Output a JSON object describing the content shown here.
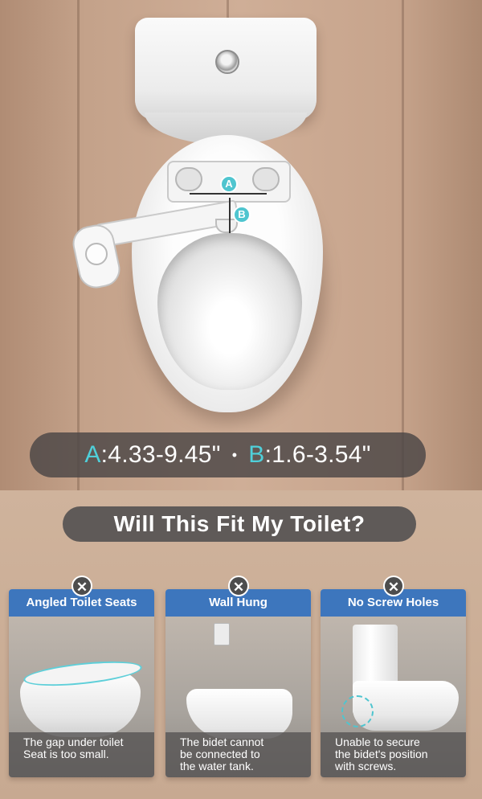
{
  "hero": {
    "label_a": "A",
    "label_b": "B",
    "measure": {
      "a_key": "A",
      "a_value": ":4.33-9.45\"",
      "separator": "•",
      "b_key": "B",
      "b_value": ":1.6-3.54\""
    }
  },
  "question": "Will This Fit My Toilet?",
  "cards": [
    {
      "icon": "x-icon",
      "title": "Angled Toilet Seats",
      "caption_lines": [
        "The gap under toilet",
        "Seat is too small."
      ]
    },
    {
      "icon": "x-icon",
      "title": "Wall Hung",
      "caption_lines": [
        "The bidet cannot",
        "be connected to",
        "the water tank."
      ]
    },
    {
      "icon": "x-icon",
      "title": "No Screw Holes",
      "caption_lines": [
        "Unable to secure",
        "the bidet's position",
        "with screws."
      ]
    }
  ],
  "x_glyph": "✕",
  "colors": {
    "accent": "#4fc5cf",
    "card_header": "#3d76bd",
    "pill_bg": "#5f5a58"
  }
}
